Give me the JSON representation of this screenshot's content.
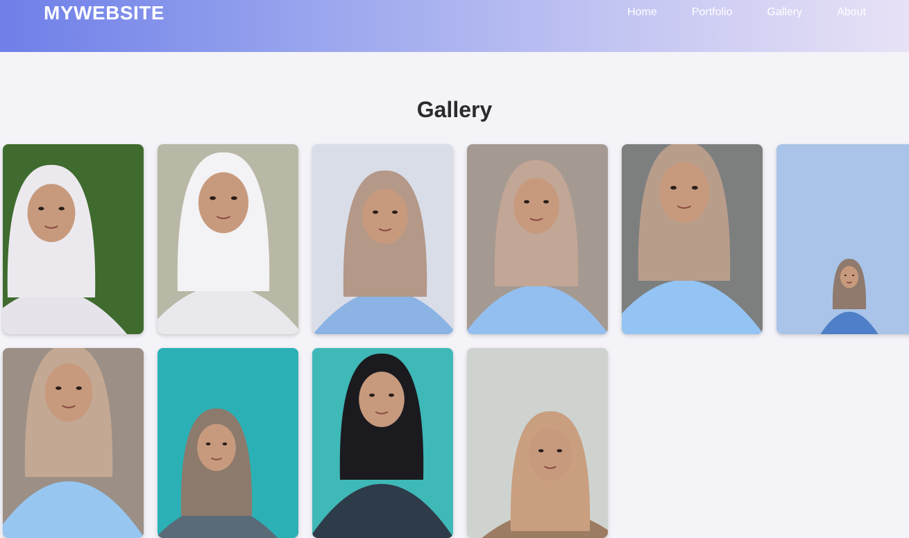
{
  "header": {
    "logo": "MYWEBSITE",
    "nav": [
      "Home",
      "Portfolio",
      "Gallery",
      "About"
    ]
  },
  "main": {
    "title": "Gallery"
  },
  "colors": {
    "header_gradient_start": "#6e7fe8",
    "header_gradient_end": "#e8e2f6",
    "page_background": "#f4f3f8",
    "title_text": "#2b2b2b"
  },
  "gallery": {
    "photos": [
      {
        "bg": "#3f6b2e",
        "scarf": "#ece9ee",
        "cloth": "#e6e3ea"
      },
      {
        "bg": "#b9b7a6",
        "scarf": "#f3f2f4",
        "cloth": "#e9e8ec"
      },
      {
        "bg": "#d9dde8",
        "scarf": "#b49888",
        "cloth": "#8bb3e4"
      },
      {
        "bg": "#a59a92",
        "scarf": "#c2a696",
        "cloth": "#93bff0"
      },
      {
        "bg": "#7d7f7f",
        "scarf": "#b89d8b",
        "cloth": "#94c4f3"
      },
      {
        "bg": "#a9c4e8",
        "scarf": "#8f7a6d",
        "cloth": "#4f7fc8"
      },
      {
        "bg": "#9b8f86",
        "scarf": "#c3a893",
        "cloth": "#97c6f1"
      },
      {
        "bg": "#2bb1b5",
        "scarf": "#8c7a6c",
        "cloth": "#5a6b78"
      },
      {
        "bg": "#3fb8b8",
        "scarf": "#1b1b1f",
        "cloth": "#2e3b48"
      },
      {
        "bg": "#cfd3d0",
        "scarf": "#c99f7f",
        "cloth": "#9c7c62"
      }
    ]
  }
}
